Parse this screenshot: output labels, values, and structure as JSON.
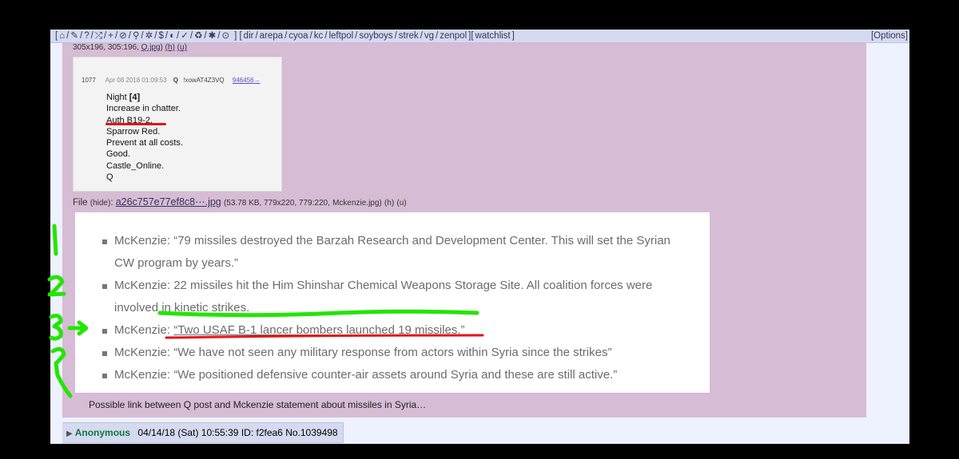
{
  "topbar": {
    "icons": [
      "home-icon",
      "tag-icon",
      "question-icon",
      "shuffle-icon",
      "plus-icon",
      "ban-icon",
      "search-icon",
      "gear-icon",
      "dollar-icon",
      "contrast-icon",
      "twitter-icon",
      "recycle-icon",
      "bug-icon",
      "check-icon"
    ],
    "icon_glyphs": [
      "⌂",
      "✎",
      "?",
      "⤮",
      "+",
      "⊘",
      "⚲",
      "✲",
      "$",
      "◐",
      "✓",
      "♻",
      "✱",
      "⊙"
    ],
    "boards": [
      "dir",
      "arepa",
      "cyoa",
      "kc",
      "leftpol",
      "soyboys",
      "strek",
      "vg",
      "zenpol"
    ],
    "watchlist": "watchlist",
    "options": "[Options]"
  },
  "post": {
    "thumb_meta": "305x196, 305:196,",
    "thumb_link": "Q.jpg",
    "h": "(h)",
    "u": "(u)",
    "qimage": {
      "num": "1077",
      "date": "Apr 08 2018 01:09:53",
      "q": "Q",
      "trip": "!xowAT4Z3VQ",
      "ref": "946456→",
      "lines": [
        "Night [4]",
        "Increase in chatter.",
        "Auth B19-2.",
        "Sparrow Red.",
        "Prevent at all costs.",
        "Good.",
        "Castle_Online.",
        "Q"
      ]
    },
    "file2": {
      "label": "File",
      "hide": "(hide)",
      "name": "a26c757e77ef8c8⋯.jpg",
      "meta": "(53.78 KB, 779x220, 779:220,",
      "orig": "Mckenzie.jpg",
      "h": "(h)",
      "u": "(u)"
    },
    "mckenzie": [
      "McKenzie: “79 missiles destroyed the Barzah Research and Development Center. This will set the Syrian CW program by years.”",
      "McKenzie: 22 missiles hit the Him Shinshar Chemical Weapons Storage Site. All coalition forces were involved in kinetic strikes.",
      "“Two USAF B-1 lancer bombers launched 19 missiles.”",
      "McKenzie: “We have not seen any military response from actors within Syria since the strikes”",
      "McKenzie: “We positioned defensive counter-air assets around Syria and these are still active.”"
    ],
    "mckenzie_prefix": "McKenzie: ",
    "caption": "Possible link between Q post and Mckenzie statement about missiles in Syria…"
  },
  "reply": {
    "name": "Anonymous",
    "date": "04/14/18 (Sat) 10:55:39",
    "id": "ID: f2fea6",
    "no": "No.1039498"
  },
  "colors": {
    "annotation_green": "#22e600",
    "annotation_red": "#e21616",
    "post_bg": "#d6bcd4",
    "name_green": "#117743"
  }
}
